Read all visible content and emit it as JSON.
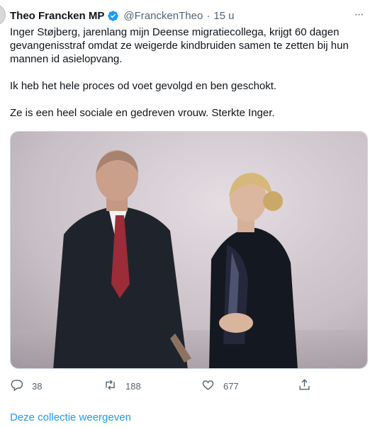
{
  "tweet": {
    "author_name": "Theo Francken MP",
    "author_handle": "@FranckenTheo",
    "separator": "·",
    "time": "15 u",
    "more_label": "···",
    "paragraphs": [
      "Inger Støjberg, jarenlang mijn Deense migratiecollega, krijgt 60 dagen gevangenisstraf omdat ze weigerde kindbruiden samen te zetten bij hun mannen id asielopvang.",
      "Ik heb het hele proces od voet gevolgd en ben geschokt.",
      "Ze is een heel sociale en gedreven vrouw. Sterkte Inger."
    ]
  },
  "actions": {
    "replies": "38",
    "retweets": "188",
    "likes": "677"
  },
  "collection_link": "Deze collectie weergeven",
  "icons": {
    "verified": "verified-badge-icon",
    "reply": "reply-icon",
    "retweet": "retweet-icon",
    "like": "heart-icon",
    "share": "share-icon",
    "more": "more-icon"
  },
  "colors": {
    "accent": "#1d9bf0",
    "secondary_text": "#536471",
    "primary_text": "#0f1419"
  }
}
